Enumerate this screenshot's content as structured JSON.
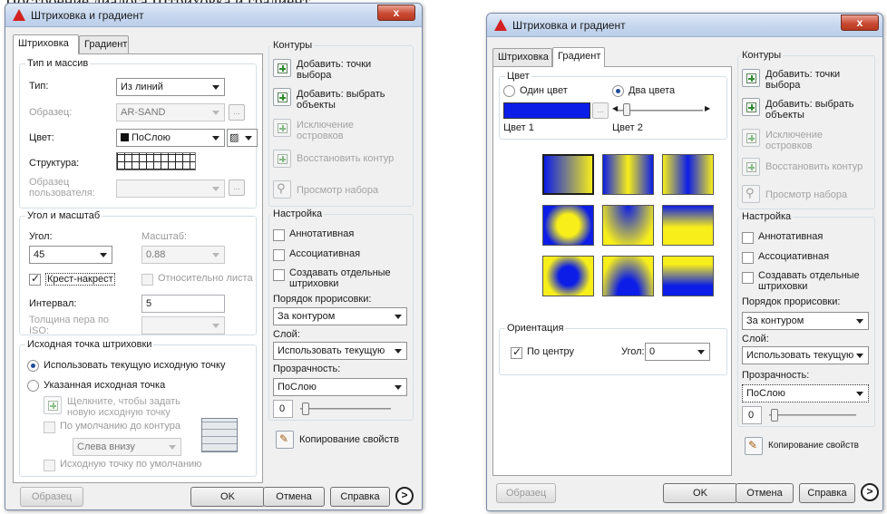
{
  "caption": "Построение диалога Штриховка и градиент.",
  "colors": {
    "gradient_blue": "#0b1de6",
    "gradient_yellow": "#f7ee1a",
    "title_gradient_top": "#dfe9f7",
    "close_red": "#c94b34"
  },
  "left": {
    "title": "Штриховка и градиент",
    "close_label": "x",
    "tabs": [
      "Штриховка",
      "Градиент"
    ],
    "type_group": {
      "label": "Тип и массив",
      "type_label": "Тип:",
      "type_value": "Из линий",
      "sample_label": "Образец:",
      "sample_value": "AR-SAND",
      "color_label": "Цвет:",
      "color_value": "ПоСлою",
      "structure_label": "Структура:",
      "user_sample_label": "Образец пользователя:"
    },
    "angle_group": {
      "label": "Угол и масштаб",
      "angle_label": "Угол:",
      "angle_value": "45",
      "scale_label": "Масштаб:",
      "scale_value": "0.88",
      "cross_label": "Крест-накрест",
      "relative_label": "Относительно листа",
      "interval_label": "Интервал:",
      "interval_value": "5",
      "iso_label": "Толщина пера по ISO:"
    },
    "origin_group": {
      "label": "Исходная точка штриховки",
      "use_current": "Использовать текущую исходную точку",
      "specified": "Указанная исходная точка",
      "click_hint": "Щелкните, чтобы задать новую исходную точку",
      "default_extent": "По умолчанию до контура",
      "corner_value": "Слева внизу",
      "store_default": "Исходную точку по умолчанию"
    },
    "contours": {
      "label": "Контуры",
      "add_pick": "Добавить: точки выбора",
      "add_select": "Добавить: выбрать объекты",
      "remove_islands": "Исключение островков",
      "recreate": "Восстановить контур",
      "view_selection": "Просмотр набора"
    },
    "settings": {
      "label": "Настройка",
      "annotative": "Аннотативная",
      "associative": "Ассоциативная",
      "separate": "Создавать отдельные штриховки",
      "draw_order_label": "Порядок прорисовки:",
      "draw_order_value": "За контуром",
      "layer_label": "Слой:",
      "layer_value": "Использовать текущую",
      "transparency_label": "Прозрачность:",
      "transparency_value": "ПоСлою",
      "transparency_number": "0"
    },
    "inherit": "Копирование свойств",
    "footer": {
      "preview": "Образец",
      "ok": "OK",
      "cancel": "Отмена",
      "help": "Справка",
      "more": ">"
    }
  },
  "right": {
    "title": "Штриховка и градиент",
    "close_label": "x",
    "tabs": [
      "Штриховка",
      "Градиент"
    ],
    "color_group": {
      "label": "Цвет",
      "one_color": "Один цвет",
      "two_colors": "Два цвета",
      "color1_label": "Цвет 1",
      "color2_label": "Цвет 2"
    },
    "gradient_grid": [
      "linear-h-yellow-right",
      "cylinder-v-yellow-center",
      "cylinder-v-blue-center",
      "spherical-yellow-center",
      "hemispherical-blue-top",
      "curved-blue-top",
      "spherical-blue-center",
      "hemispherical-blue-bottom",
      "curved-blue-bottom"
    ],
    "orientation": {
      "label": "Ориентация",
      "centered": "По центру",
      "angle_label": "Угол:",
      "angle_value": "0"
    },
    "contours": {
      "label": "Контуры",
      "add_pick": "Добавить: точки выбора",
      "add_select": "Добавить: выбрать объекты",
      "remove_islands": "Исключение островков",
      "recreate": "Восстановить контур",
      "view_selection": "Просмотр набора"
    },
    "settings": {
      "label": "Настройка",
      "annotative": "Аннотативная",
      "associative": "Ассоциативная",
      "separate": "Создавать отдельные штриховки",
      "draw_order_label": "Порядок прорисовки:",
      "draw_order_value": "За контуром",
      "layer_label": "Слой:",
      "layer_value": "Использовать текущую",
      "transparency_label": "Прозрачность:",
      "transparency_value": "ПоСлою",
      "transparency_number": "0"
    },
    "inherit": "Копирование свойств",
    "footer": {
      "preview": "Образец",
      "ok": "OK",
      "cancel": "Отмена",
      "help": "Справка",
      "more": ">"
    }
  }
}
